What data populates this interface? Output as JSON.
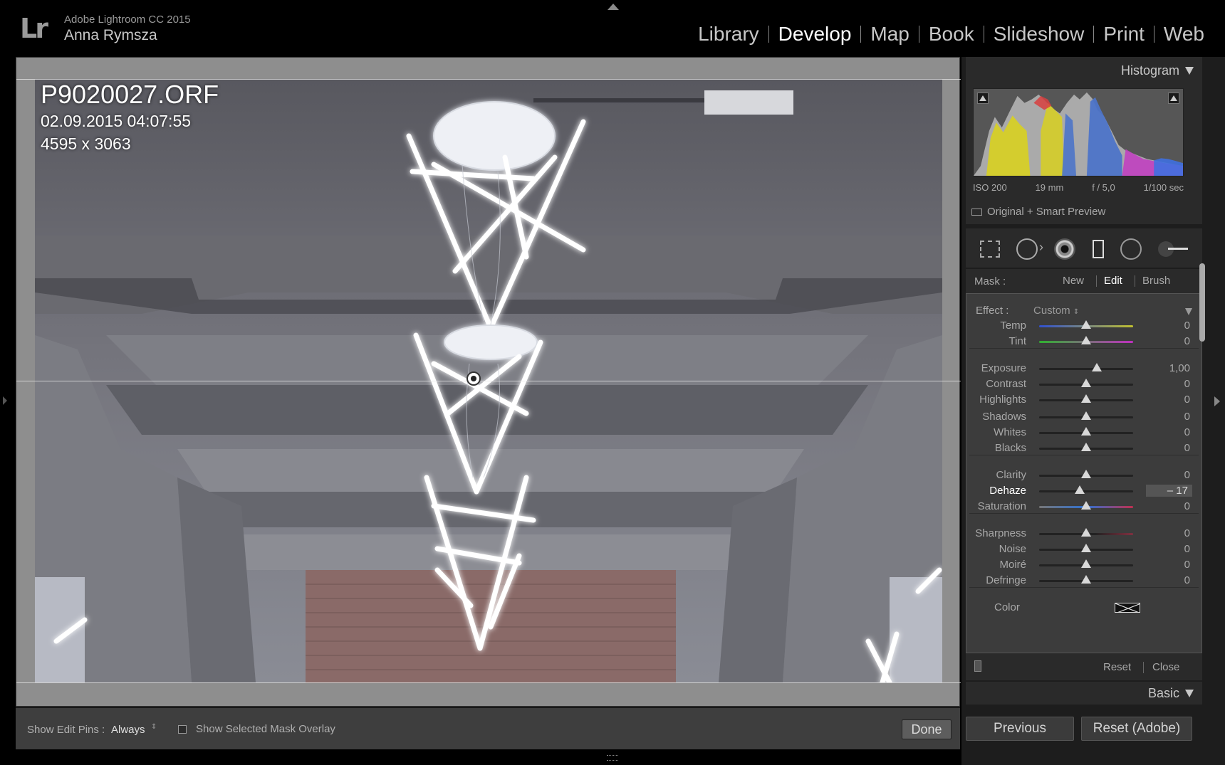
{
  "app": {
    "logo": "Lr",
    "name": "Adobe Lightroom CC 2015",
    "user": "Anna Rymsza"
  },
  "modules": [
    {
      "label": "Library",
      "active": false
    },
    {
      "label": "Develop",
      "active": true
    },
    {
      "label": "Map",
      "active": false
    },
    {
      "label": "Book",
      "active": false
    },
    {
      "label": "Slideshow",
      "active": false
    },
    {
      "label": "Print",
      "active": false
    },
    {
      "label": "Web",
      "active": false
    }
  ],
  "photo_info": {
    "filename": "P9020027.ORF",
    "datetime": "02.09.2015 04:07:55",
    "dimensions": "4595 x 3063"
  },
  "toolbar": {
    "show_pins_label": "Show Edit Pins :",
    "show_pins_value": "Always",
    "updown_icon": "⇕",
    "overlay_label": "Show Selected Mask Overlay",
    "overlay_checked": false,
    "done_label": "Done"
  },
  "histogram": {
    "title": "Histogram",
    "exif": {
      "iso": "ISO 200",
      "focal": "19 mm",
      "aperture": "f / 5,0",
      "shutter": "1/100 sec"
    },
    "preview_label": "Original + Smart Preview"
  },
  "tools": [
    "crop-icon",
    "spot-removal-icon",
    "red-eye-icon",
    "graduated-filter-icon",
    "radial-filter-icon",
    "adjustment-brush-icon"
  ],
  "mask": {
    "label": "Mask :",
    "new": "New",
    "edit": "Edit",
    "brush": "Brush"
  },
  "effect": {
    "label": "Effect :",
    "value": "Custom",
    "updown": "⇕"
  },
  "sliders": [
    {
      "label": "Temp",
      "value": "0",
      "pos": 0.5
    },
    {
      "label": "Tint",
      "value": "0",
      "pos": 0.5
    },
    {
      "label": "Exposure",
      "value": "1,00",
      "pos": 0.61
    },
    {
      "label": "Contrast",
      "value": "0",
      "pos": 0.5
    },
    {
      "label": "Highlights",
      "value": "0",
      "pos": 0.5
    },
    {
      "label": "Shadows",
      "value": "0",
      "pos": 0.5
    },
    {
      "label": "Whites",
      "value": "0",
      "pos": 0.5
    },
    {
      "label": "Blacks",
      "value": "0",
      "pos": 0.5
    },
    {
      "label": "Clarity",
      "value": "0",
      "pos": 0.5
    },
    {
      "label": "Dehaze",
      "value": "– 17",
      "pos": 0.43,
      "highlight": true
    },
    {
      "label": "Saturation",
      "value": "0",
      "pos": 0.5
    },
    {
      "label": "Sharpness",
      "value": "0",
      "pos": 0.5
    },
    {
      "label": "Noise",
      "value": "0",
      "pos": 0.5
    },
    {
      "label": "Moiré",
      "value": "0",
      "pos": 0.5
    },
    {
      "label": "Defringe",
      "value": "0",
      "pos": 0.5
    }
  ],
  "color_label": "Color",
  "panel_footer": {
    "reset": "Reset",
    "close": "Close"
  },
  "basic_title": "Basic",
  "bottom_buttons": {
    "previous": "Previous",
    "reset_adobe": "Reset (Adobe)"
  },
  "colors": {
    "active_module": "#ffffff",
    "inactive_module": "#c7c7c7",
    "panel_bg": "#2a2a2a",
    "effects_bg": "#3c3c3c"
  }
}
